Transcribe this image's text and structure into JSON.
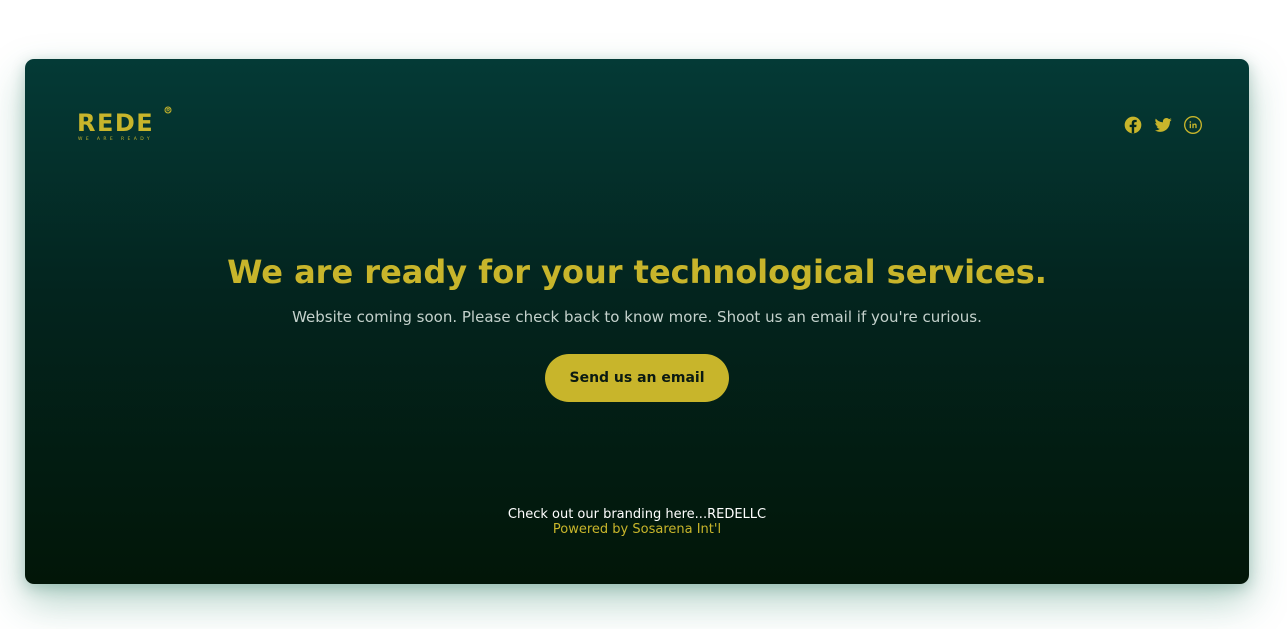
{
  "brand": {
    "name": "REDE",
    "tagline": "WE ARE READY",
    "accent_color": "#c8b52b",
    "background_top": "#043a36",
    "background_bottom": "#021608"
  },
  "socials": [
    {
      "name": "facebook",
      "icon": "facebook-icon"
    },
    {
      "name": "twitter",
      "icon": "twitter-icon"
    },
    {
      "name": "linkedin",
      "icon": "linkedin-icon"
    }
  ],
  "hero": {
    "headline": "We are ready for your technological services.",
    "subline": "Website coming soon. Please check back to know more. Shoot us an email if you're curious.",
    "cta_label": "Send us an email"
  },
  "footer": {
    "branding_text": "Check out our branding here...",
    "branding_link": "REDELLC",
    "powered_by": "Powered by Sosarena Int'l"
  }
}
